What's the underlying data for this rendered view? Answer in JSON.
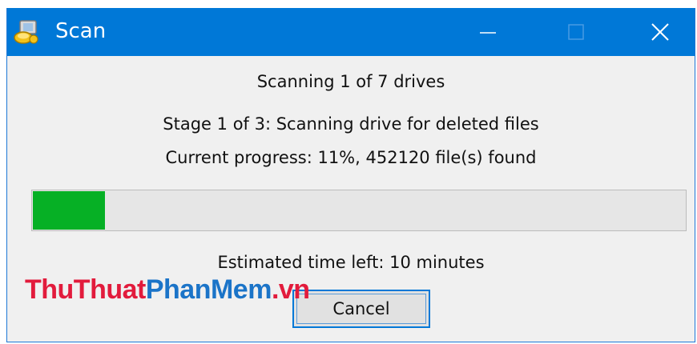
{
  "window": {
    "title": "Scan",
    "app_icon": "scan-app-icon",
    "controls": {
      "minimize": "minimize-icon",
      "maximize": "maximize-icon",
      "close": "close-icon"
    },
    "accent_color": "#0078d7"
  },
  "status": {
    "drives": "Scanning 1 of 7 drives",
    "stage": "Stage 1 of 3: Scanning drive for deleted files",
    "progress": "Current progress: 11%, 452120 file(s) found",
    "eta": "Estimated time left: 10 minutes"
  },
  "progress_bar": {
    "percent": 11,
    "fill_color": "#06b025"
  },
  "buttons": {
    "cancel": "Cancel"
  },
  "watermark": {
    "part1": "ThuThuat",
    "part2": "PhanMem",
    "part3": ".vn"
  }
}
